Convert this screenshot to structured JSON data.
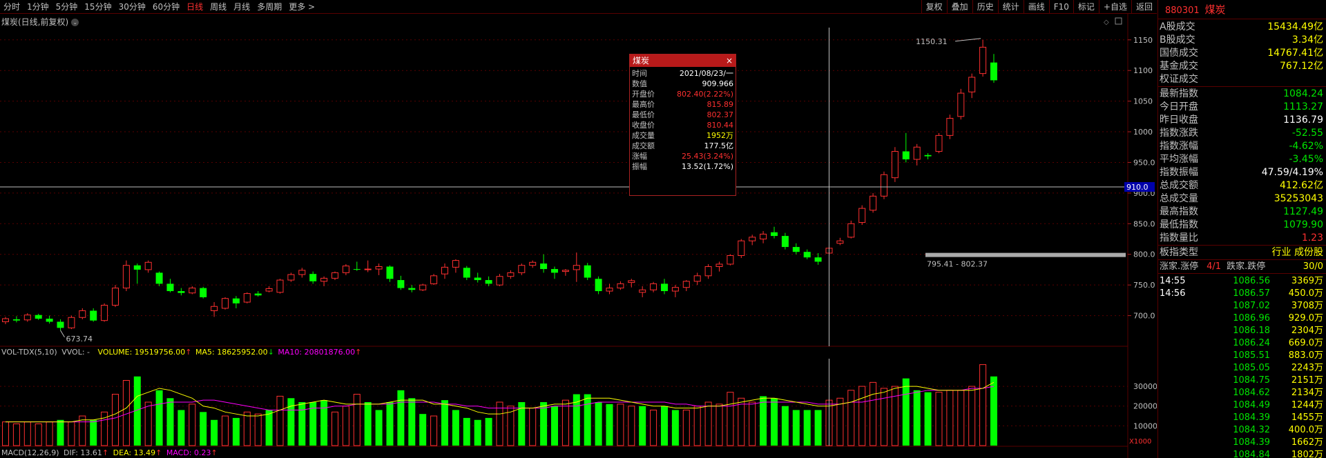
{
  "toolbar": {
    "periods": [
      "分时",
      "1分钟",
      "5分钟",
      "15分钟",
      "30分钟",
      "60分钟",
      "日线",
      "周线",
      "月线",
      "多周期",
      "更多 >"
    ],
    "active_period": "日线",
    "tools": [
      "复权",
      "叠加",
      "历史",
      "统计",
      "画线",
      "F10",
      "标记",
      "+自选",
      "返回"
    ]
  },
  "chart": {
    "title": "煤炭(日线,前复权)",
    "price_axis": [
      "1150",
      "1100",
      "1050",
      "1000",
      "950.0",
      "900.0",
      "850.0",
      "800.0",
      "750.0",
      "700.0"
    ],
    "crosshair_price": "910.0",
    "high_mark": "1150.31",
    "low_mark": "673.74",
    "range_label": "795.41 - 802.37",
    "vol_axis": [
      "30000",
      "20000",
      "10000"
    ],
    "vol_unit": "X1000",
    "colors": {
      "up": "#ff3030",
      "down": "#00ff00",
      "ma5": "#ffff00",
      "ma10": "#ff00ff",
      "grid": "#5a0000"
    }
  },
  "volume_legend": {
    "name": "VOL-TDX(5,10)",
    "vvol": "VVOL: -",
    "volume": "VOLUME: 19519756.00",
    "ma5": "MA5: 18625952.00",
    "ma10": "MA10: 20801876.00"
  },
  "macd_legend": {
    "name": "MACD(12,26,9)",
    "dif": "DIF: 13.61",
    "dea": "DEA: 13.49",
    "macd": "MACD: 0.23"
  },
  "popup": {
    "title": "煤炭",
    "close_icon": "×",
    "rows": [
      {
        "k": "时间",
        "v": "2021/08/23/一",
        "color": "#ffffff"
      },
      {
        "k": "数值",
        "v": "909.966",
        "color": "#ffffff"
      },
      {
        "k": "开盘价",
        "v": "802.40(2.22%)",
        "color": "#ff3030"
      },
      {
        "k": "最高价",
        "v": "815.89",
        "color": "#ff3030"
      },
      {
        "k": "最低价",
        "v": "802.37",
        "color": "#ff3030"
      },
      {
        "k": "收盘价",
        "v": "810.44",
        "color": "#ff3030"
      },
      {
        "k": "成交量",
        "v": "1952万",
        "color": "#ffff00"
      },
      {
        "k": "成交额",
        "v": "177.5亿",
        "color": "#ffffff"
      },
      {
        "k": "涨幅",
        "v": "25.43(3.24%)",
        "color": "#ff3030"
      },
      {
        "k": "振幅",
        "v": "13.52(1.72%)",
        "color": "#ffffff"
      }
    ]
  },
  "panel": {
    "code": "880301",
    "name": "煤炭",
    "stats": [
      {
        "k": "A股成交",
        "v": "15434.49亿",
        "c": "yellow"
      },
      {
        "k": "B股成交",
        "v": "3.34亿",
        "c": "yellow"
      },
      {
        "k": "国债成交",
        "v": "14767.41亿",
        "c": "yellow"
      },
      {
        "k": "基金成交",
        "v": "767.12亿",
        "c": "yellow"
      },
      {
        "k": "权证成交",
        "v": "",
        "c": "yellow"
      }
    ],
    "index_stats": [
      {
        "k": "最新指数",
        "v": "1084.24",
        "c": "green"
      },
      {
        "k": "今日开盘",
        "v": "1113.27",
        "c": "green"
      },
      {
        "k": "昨日收盘",
        "v": "1136.79",
        "c": "white"
      },
      {
        "k": "指数涨跌",
        "v": "-52.55",
        "c": "green"
      },
      {
        "k": "指数涨幅",
        "v": "-4.62%",
        "c": "green"
      },
      {
        "k": "平均涨幅",
        "v": "-3.45%",
        "c": "green"
      },
      {
        "k": "指数振幅",
        "v": "47.59/4.19%",
        "c": "white"
      },
      {
        "k": "总成交额",
        "v": "412.62亿",
        "c": "yellow"
      },
      {
        "k": "总成交量",
        "v": "35253043",
        "c": "yellow"
      },
      {
        "k": "最高指数",
        "v": "1127.49",
        "c": "green"
      },
      {
        "k": "最低指数",
        "v": "1079.90",
        "c": "green"
      },
      {
        "k": "指数量比",
        "v": "1.23",
        "c": "red"
      }
    ],
    "board_type_label": "板指类型",
    "board_type_value": "行业 成份股",
    "rise_label": "涨家.涨停",
    "rise_value": "4/1",
    "fall_label": "跌家.跌停",
    "fall_value": "30/0",
    "ticks": [
      {
        "t": "14:55",
        "p": "1086.56",
        "v": "3369万"
      },
      {
        "t": "14:56",
        "p": "1086.57",
        "v": "450.0万"
      },
      {
        "t": "",
        "p": "1087.02",
        "v": "3708万"
      },
      {
        "t": "",
        "p": "1086.96",
        "v": "929.0万"
      },
      {
        "t": "",
        "p": "1086.18",
        "v": "2304万"
      },
      {
        "t": "",
        "p": "1086.24",
        "v": "669.0万"
      },
      {
        "t": "",
        "p": "1085.51",
        "v": "883.0万"
      },
      {
        "t": "",
        "p": "1085.05",
        "v": "2243万"
      },
      {
        "t": "",
        "p": "1084.75",
        "v": "2151万"
      },
      {
        "t": "",
        "p": "1084.62",
        "v": "2134万"
      },
      {
        "t": "",
        "p": "1084.49",
        "v": "1244万"
      },
      {
        "t": "",
        "p": "1084.39",
        "v": "1455万"
      },
      {
        "t": "",
        "p": "1084.32",
        "v": "400.0万"
      },
      {
        "t": "",
        "p": "1084.39",
        "v": "1662万"
      },
      {
        "t": "",
        "p": "1084.84",
        "v": "1802万"
      }
    ]
  },
  "chart_data": {
    "type": "candlestick",
    "ylim": [
      650,
      1170
    ],
    "candles": [
      [
        690,
        698,
        686,
        695
      ],
      [
        694,
        699,
        689,
        692
      ],
      [
        693,
        704,
        690,
        701
      ],
      [
        701,
        703,
        693,
        695
      ],
      [
        695,
        700,
        687,
        690
      ],
      [
        690,
        694,
        676,
        680
      ],
      [
        680,
        700,
        678,
        697
      ],
      [
        697,
        712,
        694,
        708
      ],
      [
        708,
        712,
        690,
        692
      ],
      [
        692,
        720,
        690,
        717
      ],
      [
        717,
        750,
        714,
        745
      ],
      [
        745,
        790,
        740,
        782
      ],
      [
        782,
        785,
        752,
        775
      ],
      [
        775,
        790,
        770,
        787
      ],
      [
        770,
        772,
        748,
        752
      ],
      [
        752,
        760,
        738,
        740
      ],
      [
        740,
        745,
        733,
        737
      ],
      [
        737,
        748,
        735,
        745
      ],
      [
        745,
        747,
        728,
        730
      ],
      [
        708,
        722,
        698,
        715
      ],
      [
        712,
        730,
        710,
        728
      ],
      [
        728,
        732,
        712,
        720
      ],
      [
        722,
        738,
        720,
        736
      ],
      [
        736,
        740,
        731,
        733
      ],
      [
        740,
        748,
        738,
        744
      ],
      [
        738,
        760,
        736,
        758
      ],
      [
        758,
        770,
        755,
        767
      ],
      [
        767,
        778,
        762,
        774
      ],
      [
        768,
        772,
        752,
        756
      ],
      [
        756,
        764,
        748,
        761
      ],
      [
        761,
        772,
        758,
        770
      ],
      [
        770,
        784,
        766,
        781
      ],
      [
        776,
        788,
        773,
        775
      ],
      [
        775,
        790,
        771,
        776
      ],
      [
        776,
        785,
        766,
        780
      ],
      [
        780,
        782,
        755,
        760
      ],
      [
        758,
        765,
        742,
        745
      ],
      [
        745,
        750,
        738,
        742
      ],
      [
        742,
        752,
        740,
        750
      ],
      [
        752,
        768,
        750,
        765
      ],
      [
        768,
        785,
        760,
        779
      ],
      [
        779,
        792,
        770,
        790
      ],
      [
        778,
        781,
        758,
        762
      ],
      [
        762,
        770,
        754,
        758
      ],
      [
        758,
        764,
        748,
        752
      ],
      [
        750,
        768,
        748,
        764
      ],
      [
        764,
        774,
        760,
        770
      ],
      [
        770,
        785,
        766,
        782
      ],
      [
        782,
        790,
        778,
        787
      ],
      [
        785,
        800,
        770,
        776
      ],
      [
        776,
        780,
        760,
        770
      ],
      [
        772,
        776,
        765,
        774
      ],
      [
        775,
        803,
        755,
        782
      ],
      [
        782,
        786,
        758,
        762
      ],
      [
        760,
        764,
        735,
        740
      ],
      [
        740,
        752,
        735,
        745
      ],
      [
        745,
        756,
        742,
        752
      ],
      [
        754,
        760,
        746,
        757
      ],
      [
        738,
        748,
        730,
        742
      ],
      [
        742,
        755,
        738,
        752
      ],
      [
        752,
        760,
        735,
        740
      ],
      [
        740,
        750,
        730,
        746
      ],
      [
        746,
        758,
        740,
        756
      ],
      [
        756,
        770,
        750,
        765
      ],
      [
        765,
        784,
        760,
        780
      ],
      [
        780,
        788,
        772,
        784
      ],
      [
        784,
        800,
        782,
        798
      ],
      [
        798,
        825,
        794,
        822
      ],
      [
        822,
        832,
        815,
        828
      ],
      [
        825,
        838,
        818,
        833
      ],
      [
        836,
        845,
        826,
        830
      ],
      [
        830,
        835,
        808,
        812
      ],
      [
        812,
        818,
        800,
        804
      ],
      [
        804,
        808,
        792,
        795
      ],
      [
        795,
        802,
        783,
        788
      ],
      [
        802,
        816,
        802,
        810
      ],
      [
        818,
        827,
        815,
        822
      ],
      [
        828,
        855,
        826,
        850
      ],
      [
        852,
        880,
        848,
        875
      ],
      [
        872,
        900,
        868,
        895
      ],
      [
        895,
        935,
        890,
        930
      ],
      [
        925,
        975,
        918,
        968
      ],
      [
        968,
        998,
        950,
        955
      ],
      [
        955,
        980,
        945,
        975
      ],
      [
        962,
        965,
        955,
        960
      ],
      [
        968,
        998,
        965,
        994
      ],
      [
        994,
        1028,
        988,
        1022
      ],
      [
        1025,
        1070,
        1020,
        1063
      ],
      [
        1065,
        1095,
        1055,
        1089
      ],
      [
        1095,
        1150,
        1090,
        1138
      ],
      [
        1113,
        1127,
        1080,
        1084
      ]
    ],
    "volume": [
      [
        12,
        1
      ],
      [
        11,
        1
      ],
      [
        12,
        1
      ],
      [
        11,
        1
      ],
      [
        12,
        1
      ],
      [
        13,
        0
      ],
      [
        12,
        1
      ],
      [
        15,
        1
      ],
      [
        13,
        0
      ],
      [
        17,
        1
      ],
      [
        26,
        1
      ],
      [
        33,
        1
      ],
      [
        35,
        0
      ],
      [
        22,
        1
      ],
      [
        28,
        0
      ],
      [
        24,
        0
      ],
      [
        18,
        0
      ],
      [
        21,
        1
      ],
      [
        17,
        0
      ],
      [
        13,
        0
      ],
      [
        15,
        1
      ],
      [
        14,
        0
      ],
      [
        17,
        1
      ],
      [
        16,
        1
      ],
      [
        18,
        0
      ],
      [
        25,
        1
      ],
      [
        24,
        0
      ],
      [
        22,
        0
      ],
      [
        22,
        0
      ],
      [
        23,
        0
      ],
      [
        17,
        1
      ],
      [
        20,
        1
      ],
      [
        26,
        1
      ],
      [
        22,
        0
      ],
      [
        18,
        0
      ],
      [
        22,
        0
      ],
      [
        28,
        0
      ],
      [
        24,
        0
      ],
      [
        16,
        0
      ],
      [
        15,
        1
      ],
      [
        23,
        0
      ],
      [
        18,
        0
      ],
      [
        14,
        0
      ],
      [
        13,
        0
      ],
      [
        14,
        0
      ],
      [
        22,
        1
      ],
      [
        20,
        1
      ],
      [
        22,
        0
      ],
      [
        19,
        1
      ],
      [
        22,
        0
      ],
      [
        20,
        0
      ],
      [
        23,
        1
      ],
      [
        26,
        0
      ],
      [
        26,
        0
      ],
      [
        22,
        0
      ],
      [
        21,
        0
      ],
      [
        21,
        1
      ],
      [
        20,
        1
      ],
      [
        20,
        0
      ],
      [
        18,
        1
      ],
      [
        20,
        0
      ],
      [
        18,
        0
      ],
      [
        18,
        1
      ],
      [
        20,
        1
      ],
      [
        22,
        1
      ],
      [
        21,
        1
      ],
      [
        27,
        1
      ],
      [
        24,
        1
      ],
      [
        22,
        1
      ],
      [
        25,
        0
      ],
      [
        24,
        0
      ],
      [
        20,
        0
      ],
      [
        18,
        0
      ],
      [
        18,
        0
      ],
      [
        18,
        0
      ],
      [
        23,
        1
      ],
      [
        24,
        1
      ],
      [
        28,
        1
      ],
      [
        30,
        1
      ],
      [
        32,
        1
      ],
      [
        29,
        1
      ],
      [
        30,
        1
      ],
      [
        34,
        0
      ],
      [
        28,
        0
      ],
      [
        27,
        0
      ],
      [
        27,
        1
      ],
      [
        28,
        1
      ],
      [
        28,
        1
      ],
      [
        30,
        1
      ],
      [
        41,
        1
      ],
      [
        35,
        0
      ]
    ],
    "ma5": [
      12,
      12,
      12,
      12,
      12,
      12,
      12,
      13,
      13,
      14,
      16,
      19,
      25,
      27,
      29,
      28,
      26,
      24,
      20,
      19,
      17,
      16,
      15,
      15,
      16,
      18,
      20,
      21,
      22,
      23,
      22,
      21,
      21,
      21,
      21,
      22,
      23,
      23,
      23,
      21,
      21,
      20,
      19,
      17,
      16,
      16,
      17,
      19,
      19,
      20,
      21,
      21,
      22,
      24,
      24,
      24,
      23,
      22,
      21,
      20,
      20,
      19,
      19,
      19,
      20,
      20,
      21,
      22,
      23,
      24,
      24,
      23,
      22,
      21,
      20,
      20,
      21,
      22,
      24,
      26,
      27,
      29,
      30,
      30,
      29,
      28,
      28,
      28,
      28,
      29,
      32
    ],
    "ma10": [
      12,
      12,
      12,
      12,
      12,
      12,
      12,
      12,
      12,
      13,
      14,
      16,
      18,
      20,
      21,
      22,
      22,
      22,
      23,
      23,
      22,
      21,
      20,
      19,
      18,
      18,
      18,
      18,
      19,
      19,
      20,
      20,
      21,
      21,
      21,
      21,
      22,
      22,
      22,
      22,
      21,
      21,
      20,
      20,
      19,
      19,
      19,
      19,
      19,
      19,
      20,
      20,
      20,
      21,
      22,
      22,
      22,
      22,
      22,
      22,
      22,
      21,
      21,
      20,
      20,
      20,
      20,
      21,
      21,
      22,
      22,
      22,
      22,
      22,
      21,
      21,
      21,
      22,
      22,
      23,
      24,
      25,
      26,
      27,
      28,
      28,
      28,
      28,
      29,
      29,
      30
    ]
  }
}
